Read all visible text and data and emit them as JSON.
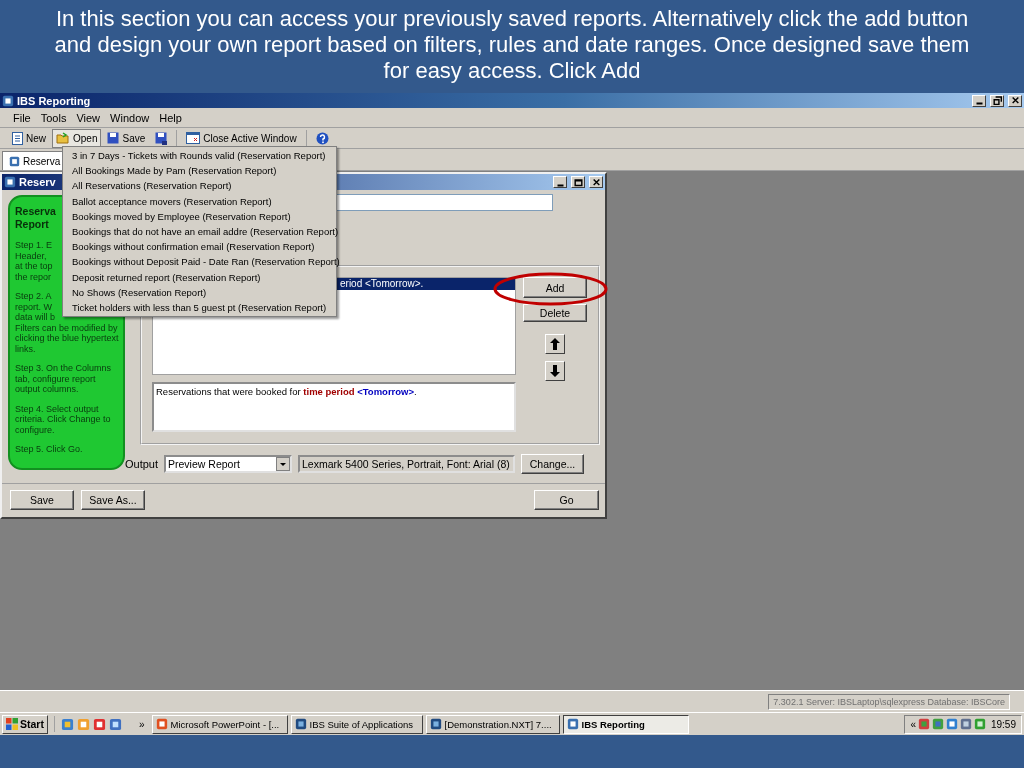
{
  "caption": "In this section you can access your previously saved reports. Alternatively click the add button and design your own report based on filters, rules and date ranges. Once designed save them for easy access. Click Add",
  "window": {
    "title": "IBS Reporting"
  },
  "menu_bar": [
    "File",
    "Tools",
    "View",
    "Window",
    "Help"
  ],
  "toolbar": [
    {
      "kind": "new",
      "label": "New",
      "pressed": false
    },
    {
      "kind": "open",
      "label": "Open",
      "pressed": true
    },
    {
      "kind": "save",
      "label": "Save",
      "pressed": false
    },
    {
      "kind": "saveas",
      "pressed": false
    },
    {
      "kind": "close",
      "label": "Close Active Window",
      "pressed": false
    },
    {
      "kind": "help",
      "pressed": false
    }
  ],
  "mdi_tabs": [
    {
      "label": "Reserva",
      "selected": true
    }
  ],
  "open_menu": {
    "items": [
      "3 in 7 Days - Tickets with Rounds valid (Reservation Report)",
      "All Bookings Made by Pam (Reservation Report)",
      "All Reservations (Reservation Report)",
      "Ballot acceptance movers (Reservation Report)",
      "Bookings moved by Employee (Reservation Report)",
      "Bookings that do not have an email addre (Reservation Report)",
      "Bookings without confirmation email (Reservation Report)",
      "Bookings without Deposit Paid - Date Ran (Reservation Report)",
      "Deposit returned report (Reservation Report)",
      "No Shows (Reservation Report)",
      "Ticket holders with less than 5 guest pt (Reservation Report)"
    ]
  },
  "report_window": {
    "title": "Reserv",
    "guide": {
      "heading": [
        "Reserva",
        "Report"
      ],
      "steps": [
        [
          "Step 1.  E",
          "Header,",
          "at the top",
          "the repor"
        ],
        [
          "Step 2.  A",
          "report.  W",
          "data will b",
          "Filters can be modified by",
          "clicking the blue hypertext",
          "links."
        ],
        [
          "Step 3. On the Columns",
          "tab, configure report",
          "output columns."
        ],
        [
          "Step 4.  Select output",
          "criteria.  Click Change to",
          "configure."
        ],
        [
          "Step 5.  Click Go."
        ]
      ]
    },
    "filters": [
      {
        "text": "eriod <Tomorrow>.",
        "selected": true
      }
    ],
    "description": [
      {
        "kind": "text",
        "text": "Reservations that were booked for "
      },
      {
        "kind": "field",
        "text": "time period "
      },
      {
        "kind": "value",
        "text": "<Tomorrow>"
      },
      {
        "kind": "text",
        "text": "."
      }
    ],
    "add_button": "Add",
    "delete_button": "Delete",
    "output": {
      "label": "Output",
      "value": "Preview Report",
      "printer": "Lexmark 5400 Series, Portrait, Font: Arial (8)",
      "change_button": "Change..."
    },
    "footer_buttons": [
      {
        "kind": "left",
        "label": "Save"
      },
      {
        "kind": "left",
        "label": "Save As..."
      },
      {
        "kind": "right",
        "label": "Go"
      }
    ]
  },
  "status_bar": "7.302.1 Server: IBSLaptop\\sqlexpress Database: IBSCore",
  "taskbar": {
    "start": "Start",
    "more": "»",
    "tasks": [
      {
        "kind": "powerpoint",
        "label": "Microsoft PowerPoint - [...",
        "selected": false
      },
      {
        "kind": "ibs",
        "label": "IBS Suite of Applications",
        "selected": false
      },
      {
        "kind": "ibs",
        "label": "[Demonstration.NXT] 7....",
        "selected": false
      },
      {
        "kind": "reporting",
        "label": "IBS Reporting",
        "selected": true
      }
    ],
    "tray_toggle": "«",
    "clock": "19:59"
  }
}
